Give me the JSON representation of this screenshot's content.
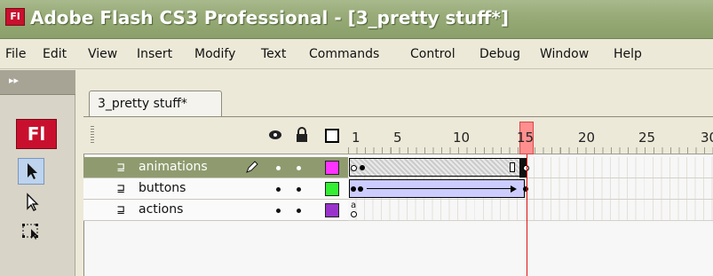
{
  "window": {
    "title": "Adobe Flash CS3 Professional - [3_pretty stuff*]",
    "app_icon": "Fl"
  },
  "menu": [
    "File",
    "Edit",
    "View",
    "Insert",
    "Modify",
    "Text",
    "Commands",
    "Control",
    "Debug",
    "Window",
    "Help"
  ],
  "tools_panel": {
    "collapse": "▸▸",
    "logo": "Fl"
  },
  "document": {
    "tab": "3_pretty stuff*"
  },
  "timeline": {
    "frame_numbers": [
      "1",
      "5",
      "10",
      "15",
      "20",
      "25",
      "30"
    ],
    "current_frame": "15",
    "column_icons": {
      "eye": "eye-icon",
      "lock": "lock-icon",
      "outline": "outline-icon"
    },
    "layers": [
      {
        "name": "animations",
        "color": "#ff33ff",
        "active": true
      },
      {
        "name": "buttons",
        "color": "#33ee33",
        "active": false
      },
      {
        "name": "actions",
        "color": "#9933cc",
        "active": false
      }
    ]
  }
}
